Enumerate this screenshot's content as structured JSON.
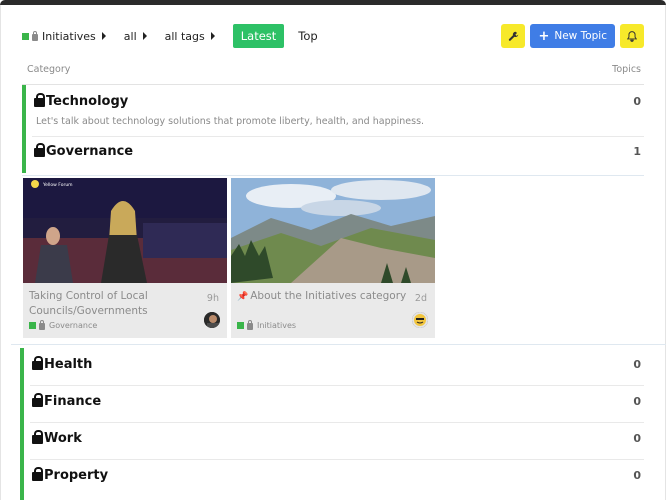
{
  "nav": {
    "category": "Initiatives",
    "filter_all": "all",
    "filter_tags": "all tags",
    "tab_latest": "Latest",
    "tab_top": "Top",
    "new_topic": "New Topic"
  },
  "headers": {
    "category": "Category",
    "topics": "Topics"
  },
  "categories": [
    {
      "name": "Technology",
      "count": "0",
      "description": "Let's talk about technology solutions that promote liberty, health, and happiness."
    },
    {
      "name": "Governance",
      "count": "1"
    },
    {
      "name": "Health",
      "count": "0"
    },
    {
      "name": "Finance",
      "count": "0"
    },
    {
      "name": "Work",
      "count": "0"
    },
    {
      "name": "Property",
      "count": "0"
    }
  ],
  "cards": [
    {
      "title": "Taking Control of Local Councils/Governments",
      "age": "9h",
      "category": "Governance",
      "image_caption": "Yellow Forum"
    },
    {
      "title": "About the Initiatives category",
      "age": "2d",
      "category": "Initiatives"
    }
  ],
  "colors": {
    "accent": "#3ab54a",
    "latest": "#2dc166",
    "primary": "#3f7de6",
    "yellow": "#f7e92a"
  },
  "icons": [
    "wrench-icon",
    "plus-icon",
    "bell-icon",
    "lock-icon",
    "pin-icon",
    "caret-right-icon"
  ]
}
